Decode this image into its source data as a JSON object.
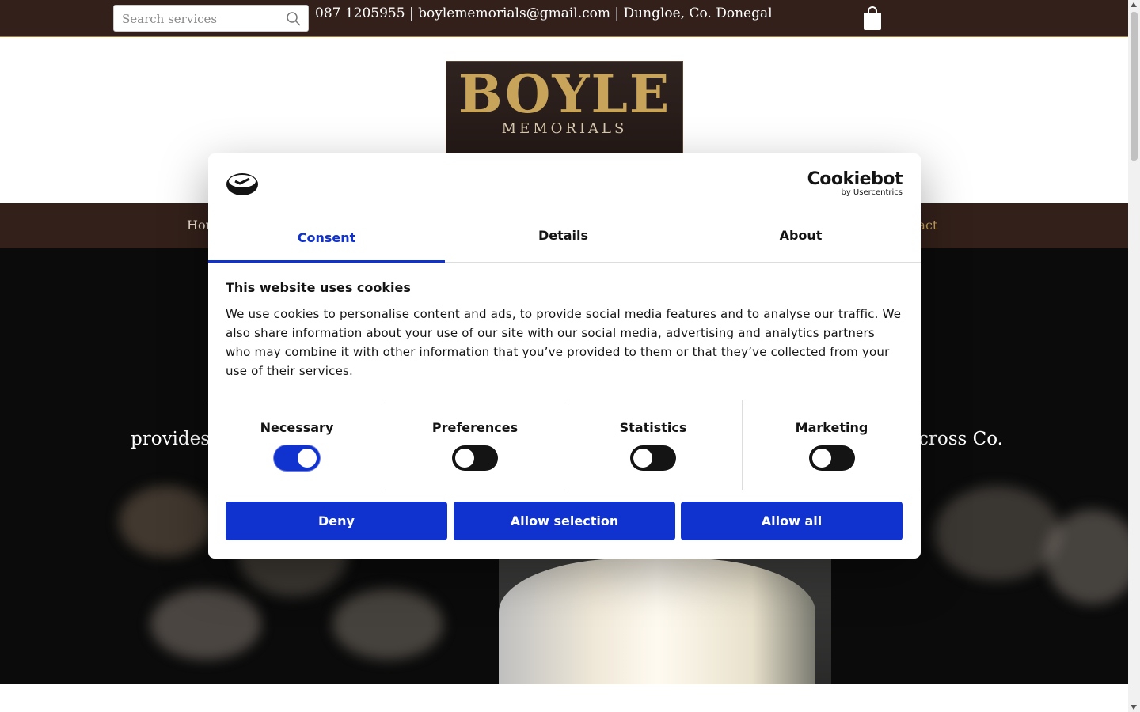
{
  "topbar": {
    "search_placeholder": "Search services",
    "contact_line": "087 1205955 | boylememorials@gmail.com | Dungloe, Co. Donegal"
  },
  "header": {
    "logo_line1": "BOYLE",
    "logo_line2": "MEMORIALS"
  },
  "nav": {
    "home_visible": "Hon",
    "contact_visible": "tact"
  },
  "hero": {
    "text_left": "provides",
    "text_right": "cross Co."
  },
  "cookie": {
    "brand": "Cookiebot",
    "brand_sub": "by Usercentrics",
    "tabs": [
      "Consent",
      "Details",
      "About"
    ],
    "active_tab": 0,
    "heading": "This website uses cookies",
    "body": "We use cookies to personalise content and ads, to provide social media features and to analyse our traffic. We also share information about your use of our site with our social media, advertising and analytics partners who may combine it with other information that you’ve provided to them or that they’ve collected from your use of their services.",
    "categories": [
      {
        "label": "Necessary",
        "enabled": true
      },
      {
        "label": "Preferences",
        "enabled": false
      },
      {
        "label": "Statistics",
        "enabled": false
      },
      {
        "label": "Marketing",
        "enabled": false
      }
    ],
    "buttons": {
      "deny": "Deny",
      "allow_selection": "Allow selection",
      "allow_all": "Allow all"
    },
    "accent_color": "#1032cf"
  },
  "colors": {
    "brand_brown": "#33201a",
    "gold": "#c9a35c"
  }
}
